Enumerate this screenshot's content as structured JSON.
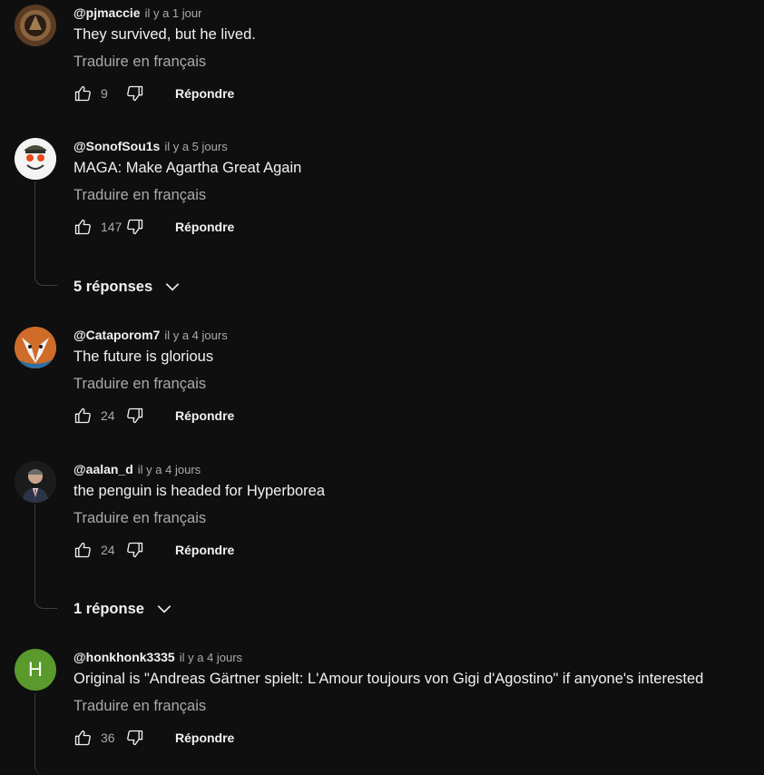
{
  "comments": [
    {
      "handle": "@pjmaccie",
      "time": "il y a 1 jour",
      "text": "They survived, but he lived.",
      "translate": "Traduire en français",
      "likes": "9",
      "reply": "Répondre"
    },
    {
      "handle": "@SonofSou1s",
      "time": "il y a 5 jours",
      "text": "MAGA: Make Agartha Great Again",
      "translate": "Traduire en français",
      "likes": "147",
      "reply": "Répondre",
      "replies": "5 réponses"
    },
    {
      "handle": "@Cataporom7",
      "time": "il y a 4 jours",
      "text": "The future is glorious",
      "translate": "Traduire en français",
      "likes": "24",
      "reply": "Répondre"
    },
    {
      "handle": "@aalan_d",
      "time": "il y a 4 jours",
      "text": "the penguin is headed for Hyperborea",
      "translate": "Traduire en français",
      "likes": "24",
      "reply": "Répondre",
      "replies": "1 réponse"
    },
    {
      "handle": "@honkhonk3335",
      "time": "il y a 4 jours",
      "text": "Original is \"Andreas Gärtner spielt: L'Amour toujours von Gigi d'Agostino\" if anyone's interested",
      "translate": "Traduire en français",
      "likes": "36",
      "reply": "Répondre",
      "avatar_letter": "H"
    }
  ],
  "colors": {
    "background": "#0f0f0f",
    "secondary_text": "#aaaaaa",
    "avatar_h": "#5a9a2c"
  },
  "icons": {
    "like": "thumbs-up-icon",
    "dislike": "thumbs-down-icon",
    "expand": "chevron-down-icon"
  }
}
